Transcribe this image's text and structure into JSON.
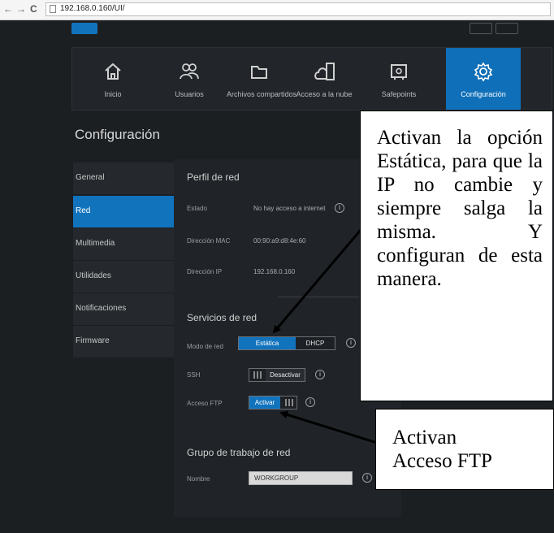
{
  "browser": {
    "back_glyph": "←",
    "forward_glyph": "→",
    "reload_glyph": "C",
    "url": "192.168.0.160/UI/"
  },
  "tabs": [
    {
      "label": "Inicio",
      "icon": "home-icon",
      "active": false
    },
    {
      "label": "Usuarios",
      "icon": "users-icon",
      "active": false
    },
    {
      "label": "Archivos compartidos",
      "icon": "folder-icon",
      "active": false
    },
    {
      "label": "Acceso a la nube",
      "icon": "cloud-device-icon",
      "active": false
    },
    {
      "label": "Safepoints",
      "icon": "safe-icon",
      "active": false
    },
    {
      "label": "Configuración",
      "icon": "gear-icon",
      "active": true
    }
  ],
  "page_title": "Configuración",
  "sidebar": [
    {
      "label": "General",
      "active": false
    },
    {
      "label": "Red",
      "active": true
    },
    {
      "label": "Multimedia",
      "active": false
    },
    {
      "label": "Utilidades",
      "active": false
    },
    {
      "label": "Notificaciones",
      "active": false
    },
    {
      "label": "Firmware",
      "active": false
    }
  ],
  "perfil": {
    "title": "Perfil de red",
    "estado_label": "Estado",
    "estado_value": "No hay acceso a internet",
    "mac_label": "Dirección MAC",
    "mac_value": "00:90:a9:d8:4e:60",
    "ip_label": "Dirección IP",
    "ip_value": "192.168.0.160"
  },
  "servicios": {
    "title": "Servicios de red",
    "modo_label": "Modo de red",
    "modo_static": "Estática",
    "modo_dhcp": "DHCP",
    "ssh_label": "SSH",
    "ssh_value": "Desactivar",
    "ftp_label": "Acceso FTP",
    "ftp_value": "Activar"
  },
  "grupo": {
    "title": "Grupo de trabajo de red",
    "nombre_label": "Nombre",
    "nombre_value": "WORKGROUP"
  },
  "info_glyph": "i",
  "annotations": {
    "callout1": "Activan la opción Estática, para que la IP no cambie y siempre salga la misma. Y configuran de esta manera.",
    "callout2_line1": "Activan",
    "callout2_line2": "Acceso FTP"
  }
}
